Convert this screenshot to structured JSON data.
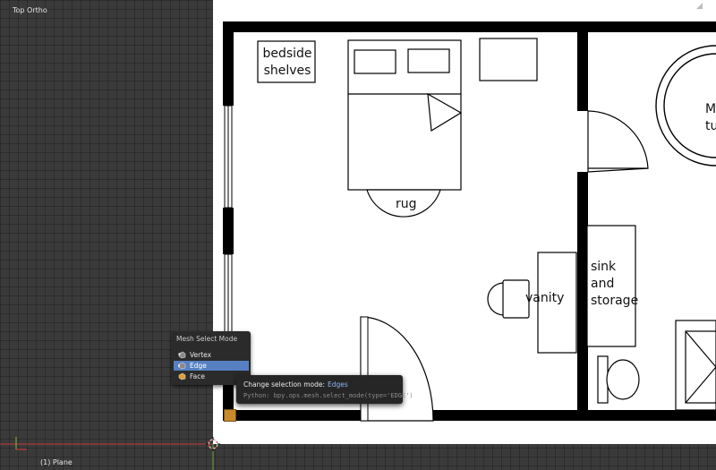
{
  "viewport": {
    "view_label": "Top Ortho",
    "object_label": "(1) Plane"
  },
  "floorplan": {
    "labels": {
      "bedside_shelves": "bedside\nshelves",
      "rug": "rug",
      "vanity": "vanity",
      "sink_storage": "sink\nand\nstorage",
      "tub_partial": "M\ntu"
    }
  },
  "menu": {
    "title": "Mesh Select Mode",
    "items": [
      {
        "label": "Vertex",
        "icon": "vertex-select-icon"
      },
      {
        "label": "Edge",
        "icon": "edge-select-icon",
        "active": true
      },
      {
        "label": "Face",
        "icon": "face-select-icon"
      }
    ]
  },
  "tooltip": {
    "description": "Change selection mode:",
    "value": "Edges",
    "python": "Python: bpy.ops.mesh.select_mode(type='EDGE')"
  },
  "colors": {
    "viewport_bg": "#3a3a3a",
    "menu_highlight": "#5680c2",
    "tooltip_value": "#8fb5f0",
    "axis_x": "#c43a3a",
    "axis_y": "#6fa73a"
  }
}
